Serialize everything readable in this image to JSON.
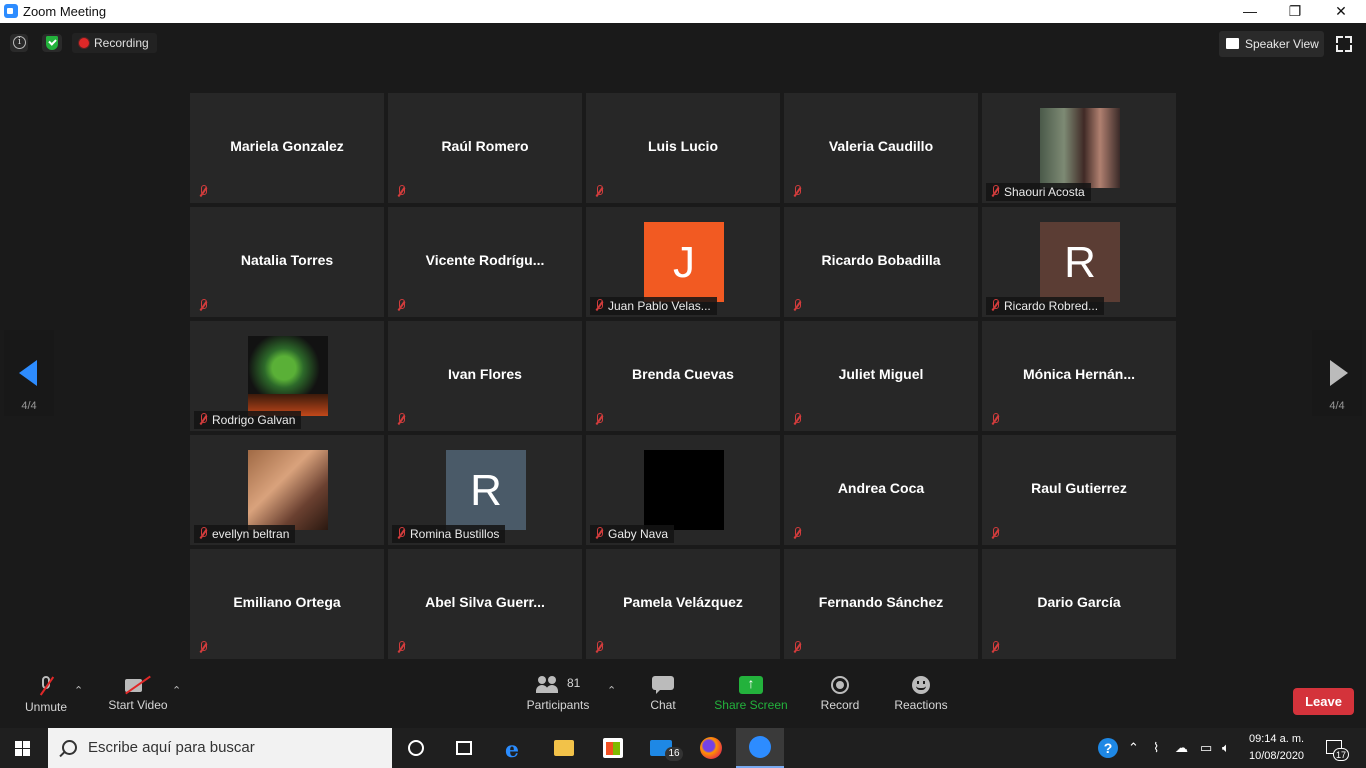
{
  "window": {
    "title": "Zoom Meeting",
    "minimize": "—",
    "restore": "❐",
    "close": "✕"
  },
  "top": {
    "recording": "Recording",
    "speaker_view": "Speaker View",
    "page_left": "4/4",
    "page_right": "4/4"
  },
  "tiles": [
    {
      "name": "Mariela Gonzalez"
    },
    {
      "name": "Raúl Romero"
    },
    {
      "name": "Luis Lucio"
    },
    {
      "name": "Valeria Caudillo"
    },
    {
      "label": "Shaouri Acosta",
      "avatar": "photo-girl2"
    },
    {
      "name": "Natalia Torres"
    },
    {
      "name": "Vicente  Rodrígu..."
    },
    {
      "label": "Juan Pablo Velas...",
      "letter": "J",
      "letter_bg": "#f25a22"
    },
    {
      "name": "Ricardo Bobadilla"
    },
    {
      "label": "Ricardo Robred...",
      "letter": "R",
      "letter_bg": "#5b3d34"
    },
    {
      "label": "Rodrigo Galvan",
      "avatar": "photo-green"
    },
    {
      "name": "Ivan Flores"
    },
    {
      "name": "Brenda Cuevas"
    },
    {
      "name": "Juliet Miguel"
    },
    {
      "name": "Mónica  Hernán..."
    },
    {
      "label": "evellyn beltran",
      "avatar": "photo-girl"
    },
    {
      "label": "Romina Bustillos",
      "letter": "R",
      "letter_bg": "#4a5a68"
    },
    {
      "label": "Gaby Nava",
      "avatar": "black"
    },
    {
      "name": "Andrea Coca"
    },
    {
      "name": "Raul Gutierrez"
    },
    {
      "name": "Emiliano Ortega"
    },
    {
      "name": "Abel  Silva  Guerr..."
    },
    {
      "name": "Pamela Velázquez"
    },
    {
      "name": "Fernando Sánchez"
    },
    {
      "name": "Dario García"
    }
  ],
  "toolbar": {
    "unmute": "Unmute",
    "start_video": "Start Video",
    "participants": "Participants",
    "participants_count": "81",
    "chat": "Chat",
    "share_screen": "Share Screen",
    "record": "Record",
    "reactions": "Reactions",
    "leave": "Leave"
  },
  "taskbar": {
    "search_placeholder": "Escribe aquí para buscar",
    "mail_badge": "16",
    "time": "09:14 a. m.",
    "date": "10/08/2020",
    "notifications": "17"
  },
  "colors": {
    "accent": "#2d8cff",
    "leave": "#d4333b",
    "share": "#23b23c",
    "mute": "#d23c3c"
  }
}
